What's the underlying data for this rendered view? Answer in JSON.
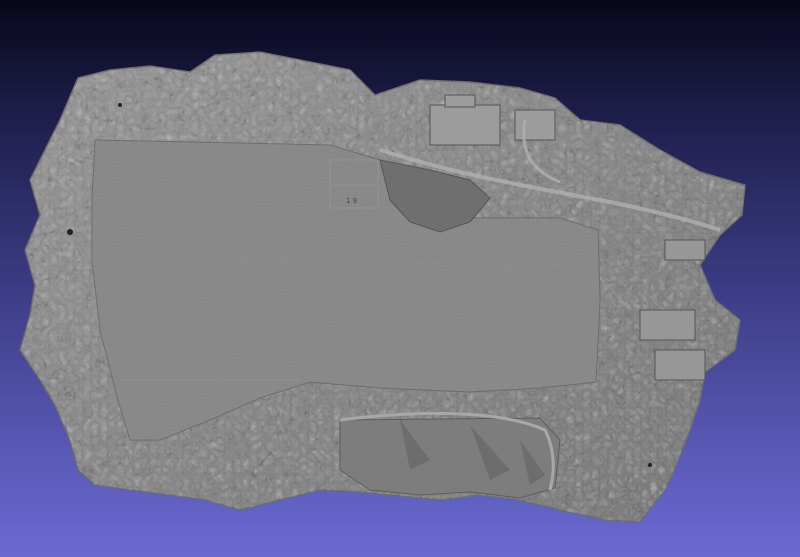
{
  "viewport": {
    "background_top": "#07071a",
    "background_bottom": "#6a6ad2"
  },
  "mesh": {
    "color_base": "#8a8a8a",
    "color_field": "#7e7e7e",
    "color_shadow": "#5d5d5d",
    "color_highlight": "#b4b4b4"
  },
  "field_label": "1 9"
}
